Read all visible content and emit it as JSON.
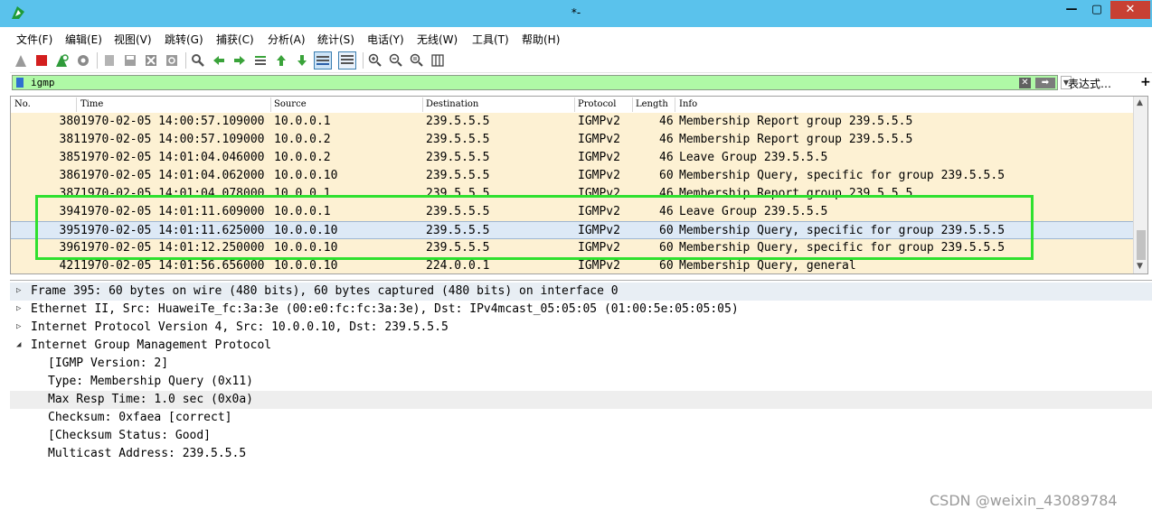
{
  "window": {
    "title": "*-",
    "minimize": "—",
    "maximize": "▢",
    "close": "✕"
  },
  "menu": [
    "文件(F)",
    "编辑(E)",
    "视图(V)",
    "跳转(G)",
    "捕获(C)",
    "分析(A)",
    "统计(S)",
    "电话(Y)",
    "无线(W)",
    "工具(T)",
    "帮助(H)"
  ],
  "toolbar": [
    "shark-fin-start-icon",
    "stop-icon",
    "restart-icon",
    "options-gear-icon",
    "open-file-icon",
    "save-file-icon",
    "close-file-icon",
    "reload-icon",
    "find-icon",
    "back-icon",
    "forward-icon",
    "go-to-packet-icon",
    "first-packet-icon",
    "last-packet-icon",
    "auto-scroll-icon",
    "colorize-icon",
    "zoom-in-icon",
    "zoom-out-icon",
    "zoom-normal-icon",
    "resize-columns-icon"
  ],
  "filter": {
    "value": "igmp",
    "expression_label": "表达式…",
    "add_label": "+",
    "clear_label": "✕",
    "apply_label": "➡"
  },
  "columns": [
    "No.",
    "Time",
    "Source",
    "Destination",
    "Protocol",
    "Length",
    "Info"
  ],
  "packets": [
    {
      "no": "380",
      "time": "1970-02-05 14:00:57.109000",
      "src": "10.0.0.1",
      "dst": "239.5.5.5",
      "proto": "IGMPv2",
      "len": "46",
      "info": "Membership Report group 239.5.5.5"
    },
    {
      "no": "381",
      "time": "1970-02-05 14:00:57.109000",
      "src": "10.0.0.2",
      "dst": "239.5.5.5",
      "proto": "IGMPv2",
      "len": "46",
      "info": "Membership Report group 239.5.5.5"
    },
    {
      "no": "385",
      "time": "1970-02-05 14:01:04.046000",
      "src": "10.0.0.2",
      "dst": "239.5.5.5",
      "proto": "IGMPv2",
      "len": "46",
      "info": "Leave Group 239.5.5.5"
    },
    {
      "no": "386",
      "time": "1970-02-05 14:01:04.062000",
      "src": "10.0.0.10",
      "dst": "239.5.5.5",
      "proto": "IGMPv2",
      "len": "60",
      "info": "Membership Query, specific for group 239.5.5.5"
    },
    {
      "no": "387",
      "time": "1970-02-05 14:01:04.078000",
      "src": "10.0.0.1",
      "dst": "239.5.5.5",
      "proto": "IGMPv2",
      "len": "46",
      "info": "Membership Report group 239.5.5.5"
    },
    {
      "no": "394",
      "time": "1970-02-05 14:01:11.609000",
      "src": "10.0.0.1",
      "dst": "239.5.5.5",
      "proto": "IGMPv2",
      "len": "46",
      "info": "Leave Group 239.5.5.5"
    },
    {
      "no": "395",
      "time": "1970-02-05 14:01:11.625000",
      "src": "10.0.0.10",
      "dst": "239.5.5.5",
      "proto": "IGMPv2",
      "len": "60",
      "info": "Membership Query, specific for group 239.5.5.5",
      "selected": true
    },
    {
      "no": "396",
      "time": "1970-02-05 14:01:12.250000",
      "src": "10.0.0.10",
      "dst": "239.5.5.5",
      "proto": "IGMPv2",
      "len": "60",
      "info": "Membership Query, specific for group 239.5.5.5"
    },
    {
      "no": "421",
      "time": "1970-02-05 14:01:56.656000",
      "src": "10.0.0.10",
      "dst": "224.0.0.1",
      "proto": "IGMPv2",
      "len": "60",
      "info": "Membership Query, general"
    }
  ],
  "details": [
    {
      "text": "Frame 395: 60 bytes on wire (480 bits), 60 bytes captured (480 bits) on interface 0",
      "arrow": "▷",
      "level": 0,
      "hl": "hl"
    },
    {
      "text": "Ethernet II, Src: HuaweiTe_fc:3a:3e (00:e0:fc:fc:3a:3e), Dst: IPv4mcast_05:05:05 (01:00:5e:05:05:05)",
      "arrow": "▷",
      "level": 0
    },
    {
      "text": "Internet Protocol Version 4, Src: 10.0.0.10, Dst: 239.5.5.5",
      "arrow": "▷",
      "level": 0
    },
    {
      "text": "Internet Group Management Protocol",
      "arrow": "◢",
      "level": 0
    },
    {
      "text": "[IGMP Version: 2]",
      "arrow": "",
      "level": 1
    },
    {
      "text": "Type: Membership Query (0x11)",
      "arrow": "",
      "level": 1
    },
    {
      "text": "Max Resp Time: 1.0 sec (0x0a)",
      "arrow": "",
      "level": 1,
      "hl": "hl2"
    },
    {
      "text": "Checksum: 0xfaea [correct]",
      "arrow": "",
      "level": 1
    },
    {
      "text": "[Checksum Status: Good]",
      "arrow": "",
      "level": 1
    },
    {
      "text": "Multicast Address: 239.5.5.5",
      "arrow": "",
      "level": 1
    }
  ],
  "watermark": "CSDN @weixin_43089784",
  "colors": {
    "titlebar": "#5ac2ec",
    "filter_bg": "#aff9a6",
    "row_bg": "#fdf1d3",
    "selected_row": "#dde9f6",
    "highlight_box": "#2fe02f"
  }
}
